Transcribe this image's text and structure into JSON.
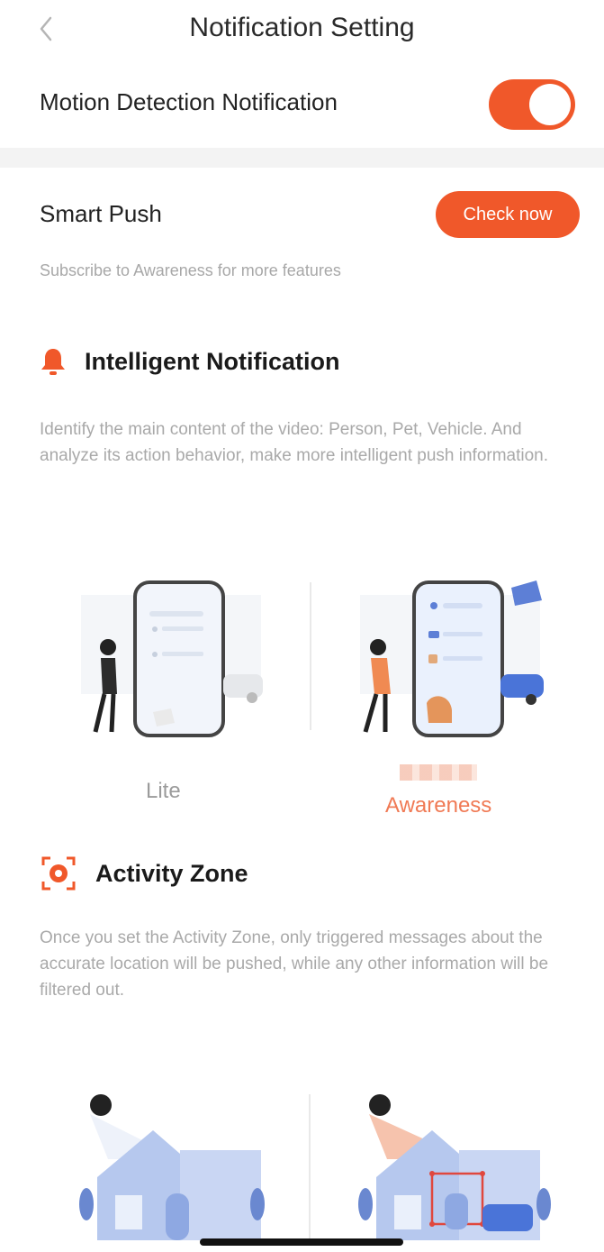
{
  "header": {
    "title": "Notification Setting"
  },
  "motion": {
    "label": "Motion Detection Notification",
    "enabled": true
  },
  "smart_push": {
    "label": "Smart Push",
    "button": "Check now",
    "subscribe_text": "Subscribe to Awareness for more features"
  },
  "intelligent": {
    "title": "Intelligent Notification",
    "description": "Identify the main content of the video: Person, Pet, Vehicle. And analyze its action behavior, make more intelligent push information."
  },
  "plans": {
    "lite": "Lite",
    "awareness": "Awareness"
  },
  "activity": {
    "title": "Activity Zone",
    "description": "Once you set the Activity Zone, only triggered messages about the accurate location will be pushed, while any other information will be filtered out."
  },
  "colors": {
    "accent": "#f0582a",
    "muted_text": "#a9a9a9"
  }
}
